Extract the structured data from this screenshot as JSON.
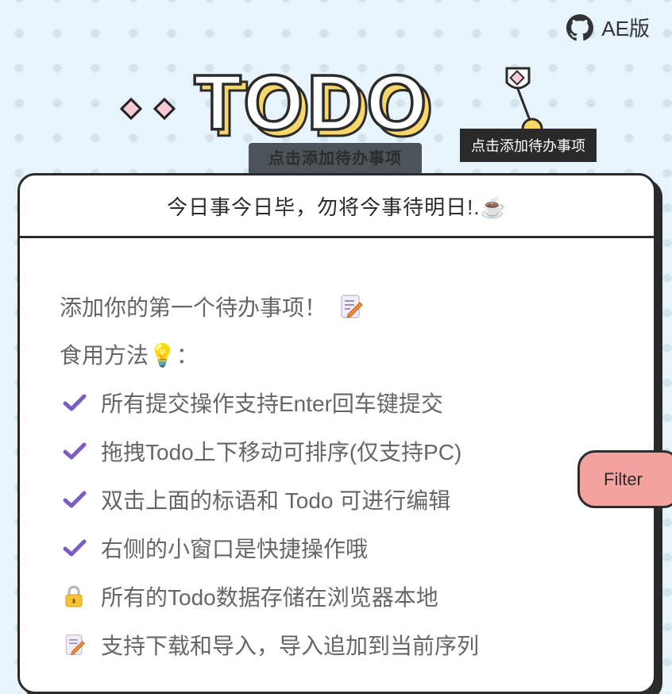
{
  "header": {
    "github_icon": "github-icon",
    "link_label": "AE版"
  },
  "logo": {
    "title": "TODO"
  },
  "tooltip": "点击添加待办事项",
  "ghost_button": "点击添加待办事项",
  "card": {
    "slogan": "今日事今日毕，勿将今事待明日!.☕",
    "intro": "添加你的第一个待办事项！",
    "usage_label": "食用方法💡：",
    "tips": [
      {
        "icon": "check-icon",
        "text": "所有提交操作支持Enter回车键提交"
      },
      {
        "icon": "check-icon",
        "text": "拖拽Todo上下移动可排序(仅支持PC)"
      },
      {
        "icon": "check-icon",
        "text": "双击上面的标语和 Todo 可进行编辑"
      },
      {
        "icon": "check-icon",
        "text": "右侧的小窗口是快捷操作哦"
      },
      {
        "icon": "lock-icon",
        "text": "所有的Todo数据存储在浏览器本地"
      },
      {
        "icon": "memo-icon",
        "text": "支持下载和导入，导入追加到当前序列"
      }
    ]
  },
  "filter_label": "Filter",
  "colors": {
    "background": "#e8f4fb",
    "check": "#7b5cc4",
    "filter": "#f4a2a0",
    "logo_shadow": "#f8d66a"
  }
}
